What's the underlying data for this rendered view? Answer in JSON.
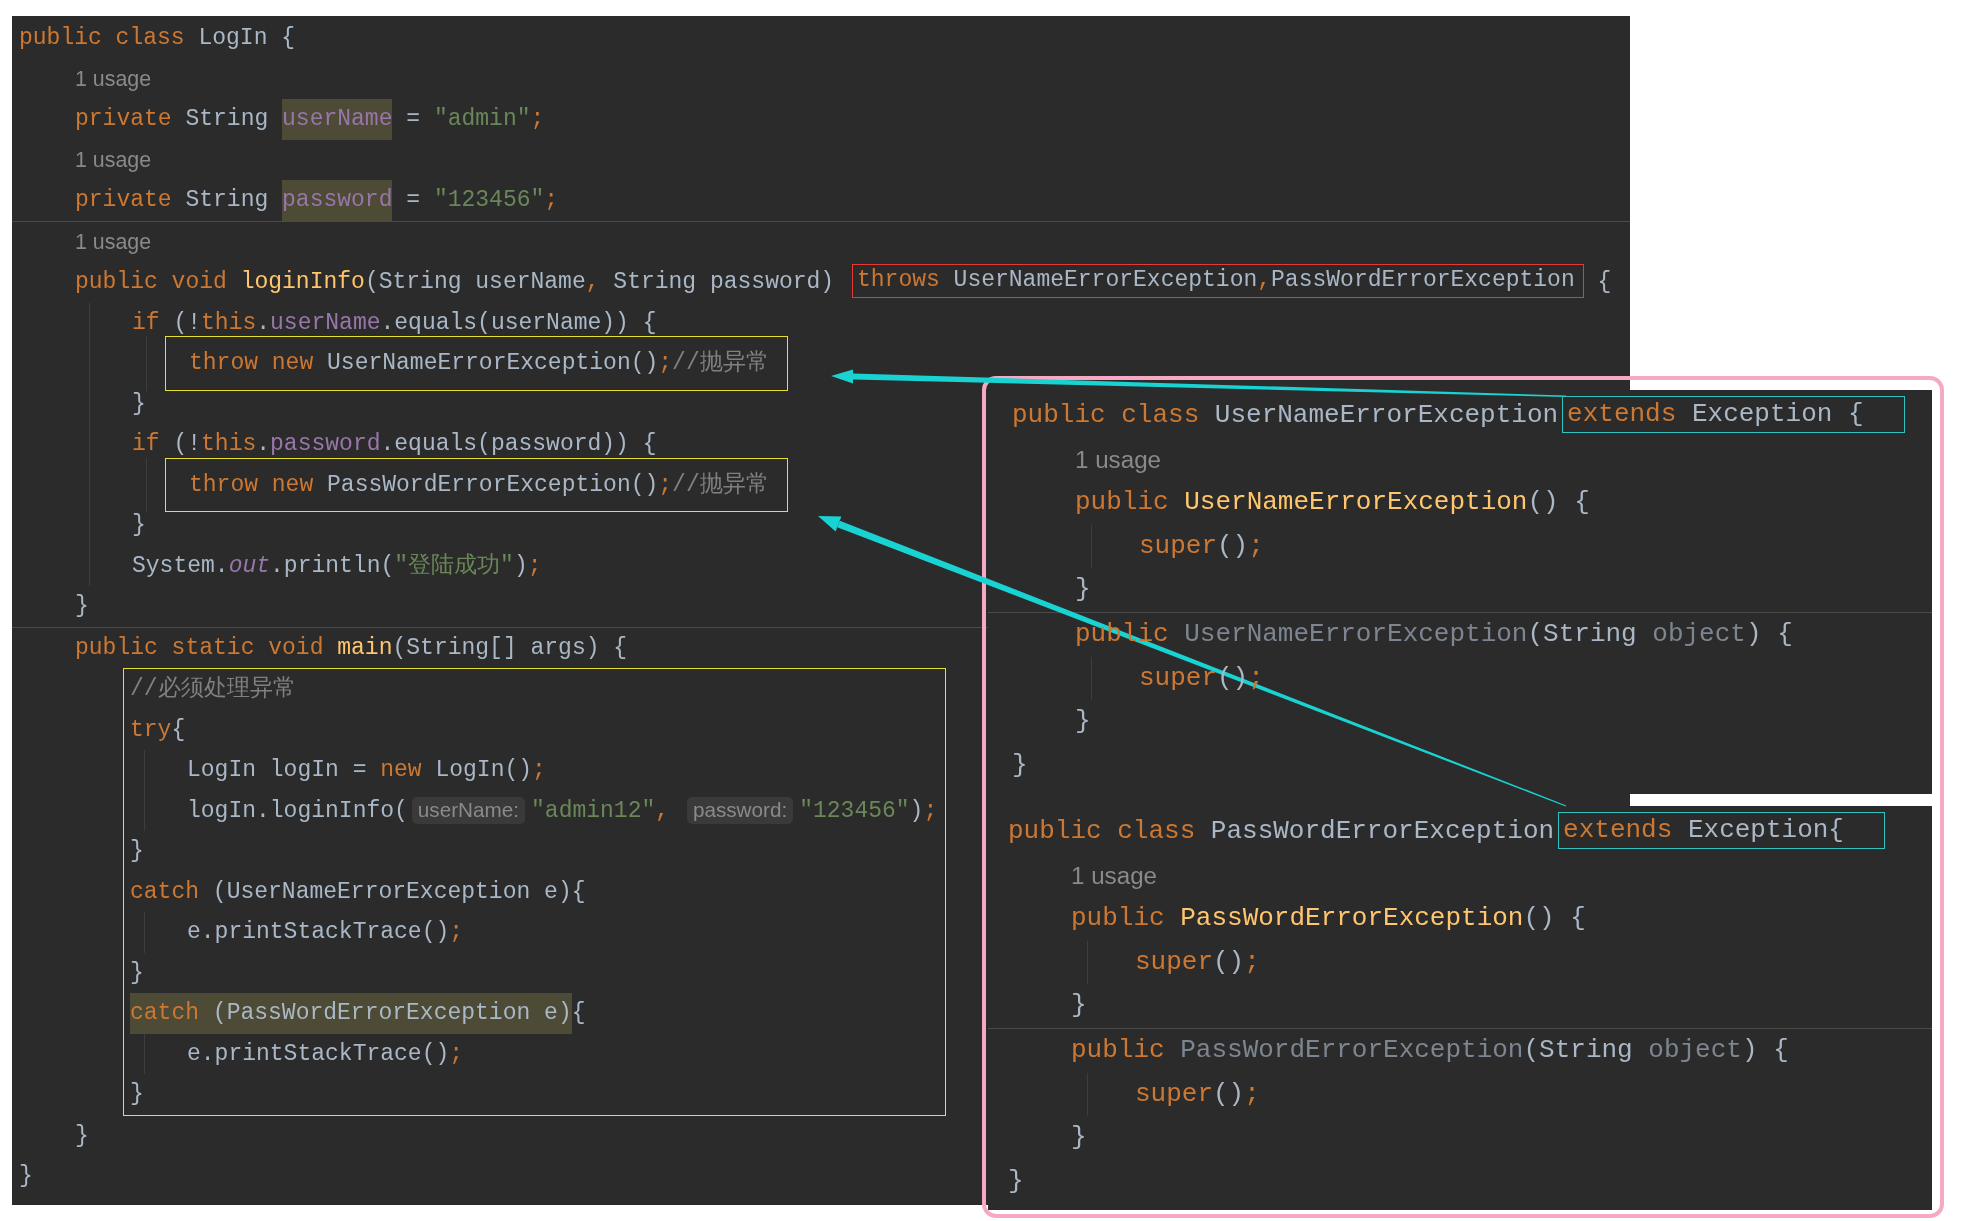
{
  "main_editor": {
    "lines": [
      {
        "kind": "code",
        "tokens": [
          {
            "kind": "keyword",
            "text": "public class "
          },
          {
            "kind": "plain",
            "text": "LogIn {"
          }
        ],
        "children": [
          {
            "kind": "hint",
            "text": "1 usage"
          },
          {
            "kind": "code",
            "tokens": [
              {
                "kind": "keyword",
                "text": "private "
              },
              {
                "kind": "plain",
                "text": "String "
              },
              {
                "kind": "field",
                "text": "userName",
                "highlighted": true
              },
              {
                "kind": "plain",
                "text": " = "
              },
              {
                "kind": "string",
                "text": "\"admin\""
              },
              {
                "kind": "keyword",
                "text": ";"
              }
            ]
          },
          {
            "kind": "hint",
            "text": "1 usage"
          },
          {
            "kind": "code",
            "separator_after": true,
            "tokens": [
              {
                "kind": "keyword",
                "text": "private "
              },
              {
                "kind": "plain",
                "text": "String "
              },
              {
                "kind": "field",
                "text": "password",
                "highlighted": true
              },
              {
                "kind": "plain",
                "text": " = "
              },
              {
                "kind": "string",
                "text": "\"123456\""
              },
              {
                "kind": "keyword",
                "text": ";"
              }
            ]
          },
          {
            "kind": "hint",
            "text": "1 usage"
          },
          {
            "kind": "code",
            "tokens": [
              {
                "kind": "keyword",
                "text": "public void "
              },
              {
                "kind": "method",
                "text": "loginInfo"
              },
              {
                "kind": "plain",
                "text": "(String userName"
              },
              {
                "kind": "keyword",
                "text": ", "
              },
              {
                "kind": "plain",
                "text": "String password) "
              },
              {
                "kind": "frame",
                "color": "#e53935",
                "tokens": [
                  {
                    "kind": "keyword",
                    "text": "throws "
                  },
                  {
                    "kind": "group",
                    "tokens": [
                      {
                        "kind": "plain",
                        "text": "UserNameErrorException"
                      },
                      {
                        "kind": "keyword",
                        "text": ","
                      }
                    ]
                  },
                  {
                    "kind": "plain",
                    "text": "PassWordErrorException"
                  }
                ]
              },
              {
                "kind": "plain",
                "text": " {"
              }
            ],
            "children": [
              {
                "kind": "code",
                "tokens": [
                  {
                    "kind": "keyword",
                    "text": "if "
                  },
                  {
                    "kind": "plain",
                    "text": "(!"
                  },
                  {
                    "kind": "keyword",
                    "text": "this"
                  },
                  {
                    "kind": "plain",
                    "text": "."
                  },
                  {
                    "kind": "field",
                    "text": "userName"
                  },
                  {
                    "kind": "plain",
                    "text": ".equals(userName)) {"
                  }
                ],
                "children": [
                  {
                    "kind": "code",
                    "frame": {
                      "color": "#e8e030"
                    },
                    "tokens": [
                      {
                        "kind": "keyword",
                        "text": "throw new "
                      },
                      {
                        "kind": "plain",
                        "text": "UserNameErrorException()"
                      },
                      {
                        "kind": "keyword",
                        "text": ";"
                      },
                      {
                        "kind": "comment",
                        "text": "//抛异常"
                      }
                    ]
                  }
                ]
              },
              {
                "kind": "code",
                "tokens": [
                  {
                    "kind": "plain",
                    "text": "}"
                  }
                ]
              },
              {
                "kind": "code",
                "tokens": [
                  {
                    "kind": "keyword",
                    "text": "if "
                  },
                  {
                    "kind": "plain",
                    "text": "(!"
                  },
                  {
                    "kind": "group",
                    "tokens": [
                      {
                        "kind": "keyword",
                        "text": "this"
                      },
                      {
                        "kind": "plain",
                        "text": "."
                      }
                    ]
                  },
                  {
                    "kind": "field",
                    "text": "password"
                  },
                  {
                    "kind": "plain",
                    "text": ".equals(password)) {"
                  }
                ],
                "children": [
                  {
                    "kind": "code",
                    "frame": {
                      "color": "#e8e030"
                    },
                    "tokens": [
                      {
                        "kind": "keyword",
                        "text": "throw new "
                      },
                      {
                        "kind": "plain",
                        "text": "PassWordErrorException()"
                      },
                      {
                        "kind": "keyword",
                        "text": ";"
                      },
                      {
                        "kind": "comment",
                        "text": "//抛异常"
                      }
                    ]
                  }
                ]
              },
              {
                "kind": "code",
                "tokens": [
                  {
                    "kind": "plain",
                    "text": "}"
                  }
                ]
              },
              {
                "kind": "code",
                "tokens": [
                  {
                    "kind": "plain",
                    "text": "System."
                  },
                  {
                    "kind": "static",
                    "text": "out"
                  },
                  {
                    "kind": "plain",
                    "text": ".println("
                  },
                  {
                    "kind": "string",
                    "text": "\"登陆成功\""
                  },
                  {
                    "kind": "plain",
                    "text": ")"
                  },
                  {
                    "kind": "keyword",
                    "text": ";"
                  }
                ]
              }
            ]
          },
          {
            "kind": "code",
            "separator_after": true,
            "tokens": [
              {
                "kind": "plain",
                "text": "}"
              }
            ]
          },
          {
            "kind": "code",
            "tokens": [
              {
                "kind": "keyword",
                "text": "public static void "
              },
              {
                "kind": "method",
                "text": "main"
              },
              {
                "kind": "plain",
                "text": "(String[] args) {"
              }
            ],
            "children_frame": {
              "color": "#e8e030"
            },
            "children": [
              {
                "kind": "code",
                "tokens": [
                  {
                    "kind": "comment",
                    "text": "//必须处理异常"
                  }
                ]
              },
              {
                "kind": "code",
                "tokens": [
                  {
                    "kind": "keyword",
                    "text": "try"
                  },
                  {
                    "kind": "plain",
                    "text": "{"
                  }
                ],
                "children": [
                  {
                    "kind": "code",
                    "tokens": [
                      {
                        "kind": "plain",
                        "text": "LogIn logIn = "
                      },
                      {
                        "kind": "keyword",
                        "text": "new "
                      },
                      {
                        "kind": "plain",
                        "text": "LogIn()"
                      },
                      {
                        "kind": "keyword",
                        "text": ";"
                      }
                    ]
                  },
                  {
                    "kind": "code",
                    "tokens": [
                      {
                        "kind": "plain",
                        "text": "logIn.loginInfo("
                      },
                      {
                        "kind": "param_hint",
                        "text": "userName:"
                      },
                      {
                        "kind": "string",
                        "text": "\"admin12\""
                      },
                      {
                        "kind": "keyword",
                        "text": ", "
                      },
                      {
                        "kind": "param_hint",
                        "text": "password:"
                      },
                      {
                        "kind": "string",
                        "text": "\"123456\""
                      },
                      {
                        "kind": "plain",
                        "text": ")"
                      },
                      {
                        "kind": "keyword",
                        "text": ";"
                      }
                    ]
                  }
                ]
              },
              {
                "kind": "code",
                "tokens": [
                  {
                    "kind": "plain",
                    "text": "}"
                  }
                ]
              },
              {
                "kind": "code",
                "tokens": [
                  {
                    "kind": "keyword",
                    "text": "catch "
                  },
                  {
                    "kind": "plain",
                    "text": "(UserNameErrorException e){"
                  }
                ],
                "children": [
                  {
                    "kind": "code",
                    "tokens": [
                      {
                        "kind": "plain",
                        "text": "e.printStackTrace()"
                      },
                      {
                        "kind": "keyword",
                        "text": ";"
                      }
                    ]
                  }
                ]
              },
              {
                "kind": "code",
                "tokens": [
                  {
                    "kind": "plain",
                    "text": "}"
                  }
                ]
              },
              {
                "kind": "code",
                "tokens": [
                  {
                    "kind": "keyword",
                    "text": "catch ",
                    "highlighted": true
                  },
                  {
                    "kind": "plain",
                    "text": "(PassWordErrorException e)",
                    "highlighted": true
                  },
                  {
                    "kind": "plain",
                    "text": "{"
                  }
                ],
                "children": [
                  {
                    "kind": "code",
                    "tokens": [
                      {
                        "kind": "plain",
                        "text": "e.printStackTrace()"
                      },
                      {
                        "kind": "keyword",
                        "text": ";"
                      }
                    ]
                  }
                ]
              },
              {
                "kind": "code",
                "tokens": [
                  {
                    "kind": "plain",
                    "text": "}"
                  }
                ]
              }
            ]
          },
          {
            "kind": "code",
            "tokens": [
              {
                "kind": "plain",
                "text": "}"
              }
            ]
          }
        ]
      },
      {
        "kind": "code",
        "tokens": [
          {
            "kind": "plain",
            "text": "}"
          }
        ]
      }
    ]
  },
  "side_snippets": [
    {
      "lines": [
        {
          "kind": "code",
          "tokens": [
            {
              "kind": "keyword",
              "text": "public class "
            },
            {
              "kind": "plain",
              "text": "UserNameErrorException"
            },
            {
              "kind": "frame",
              "color": "#2ec4c4",
              "tokens": [
                {
                  "kind": "keyword",
                  "text": "extends "
                },
                {
                  "kind": "plain",
                  "text": "Exception {"
                }
              ]
            }
          ],
          "children": [
            {
              "kind": "hint",
              "text": "1 usage"
            },
            {
              "kind": "code",
              "tokens": [
                {
                  "kind": "keyword",
                  "text": "public "
                },
                {
                  "kind": "method",
                  "text": "UserNameErrorException"
                },
                {
                  "kind": "plain",
                  "text": "() {"
                }
              ],
              "children": [
                {
                  "kind": "code",
                  "tokens": [
                    {
                      "kind": "keyword",
                      "text": "super"
                    },
                    {
                      "kind": "plain",
                      "text": "()"
                    },
                    {
                      "kind": "keyword",
                      "text": ";"
                    }
                  ]
                }
              ]
            },
            {
              "kind": "code",
              "separator_after": true,
              "tokens": [
                {
                  "kind": "plain",
                  "text": "}"
                }
              ]
            },
            {
              "kind": "code",
              "tokens": [
                {
                  "kind": "keyword",
                  "text": "public "
                },
                {
                  "kind": "unused",
                  "text": "UserNameErrorException"
                },
                {
                  "kind": "plain",
                  "text": "(String "
                },
                {
                  "kind": "unused",
                  "text": "object"
                },
                {
                  "kind": "plain",
                  "text": ") {"
                }
              ],
              "children": [
                {
                  "kind": "code",
                  "tokens": [
                    {
                      "kind": "keyword",
                      "text": "super"
                    },
                    {
                      "kind": "plain",
                      "text": "()"
                    },
                    {
                      "kind": "keyword",
                      "text": ";"
                    }
                  ]
                }
              ]
            },
            {
              "kind": "code",
              "tokens": [
                {
                  "kind": "plain",
                  "text": "}"
                }
              ]
            }
          ]
        },
        {
          "kind": "code",
          "tokens": [
            {
              "kind": "plain",
              "text": "}"
            }
          ]
        }
      ]
    },
    {
      "lines": [
        {
          "kind": "code",
          "tokens": [
            {
              "kind": "keyword",
              "text": "public class "
            },
            {
              "kind": "plain",
              "text": "PassWordErrorException"
            },
            {
              "kind": "frame",
              "color": "#2ec4c4",
              "tokens": [
                {
                  "kind": "keyword",
                  "text": "extends "
                },
                {
                  "kind": "plain",
                  "text": "Exception{"
                }
              ]
            }
          ],
          "children": [
            {
              "kind": "hint",
              "text": "1 usage"
            },
            {
              "kind": "code",
              "tokens": [
                {
                  "kind": "keyword",
                  "text": "public "
                },
                {
                  "kind": "method",
                  "text": "PassWordErrorException"
                },
                {
                  "kind": "plain",
                  "text": "() {"
                }
              ],
              "children": [
                {
                  "kind": "code",
                  "tokens": [
                    {
                      "kind": "keyword",
                      "text": "super"
                    },
                    {
                      "kind": "plain",
                      "text": "()"
                    },
                    {
                      "kind": "keyword",
                      "text": ";"
                    }
                  ]
                }
              ]
            },
            {
              "kind": "code",
              "separator_after": true,
              "tokens": [
                {
                  "kind": "plain",
                  "text": "}"
                }
              ]
            },
            {
              "kind": "code",
              "tokens": [
                {
                  "kind": "keyword",
                  "text": "public "
                },
                {
                  "kind": "unused",
                  "text": "PassWordErrorException"
                },
                {
                  "kind": "plain",
                  "text": "(String "
                },
                {
                  "kind": "unused",
                  "text": "object"
                },
                {
                  "kind": "plain",
                  "text": ") {"
                }
              ],
              "children": [
                {
                  "kind": "code",
                  "tokens": [
                    {
                      "kind": "keyword",
                      "text": "super"
                    },
                    {
                      "kind": "plain",
                      "text": "()"
                    },
                    {
                      "kind": "keyword",
                      "text": ";"
                    }
                  ]
                }
              ]
            },
            {
              "kind": "code",
              "tokens": [
                {
                  "kind": "plain",
                  "text": "}"
                }
              ]
            }
          ]
        },
        {
          "kind": "code",
          "tokens": [
            {
              "kind": "plain",
              "text": "}"
            }
          ]
        }
      ]
    }
  ]
}
